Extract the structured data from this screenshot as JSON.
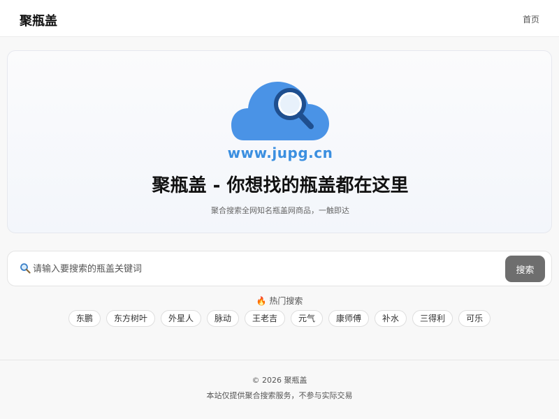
{
  "header": {
    "brand": "聚瓶盖",
    "nav_home": "首页"
  },
  "hero": {
    "logo_icon": "cloud-search-icon",
    "logo_text": "www.jupg.cn",
    "title": "聚瓶盖 - 你想找的瓶盖都在这里",
    "subtitle": "聚合搜索全网知名瓶盖网商品，一触即达"
  },
  "search": {
    "placeholder": "请输入要搜索的瓶盖关键词",
    "value": "",
    "button_label": "搜索"
  },
  "hot": {
    "title": "🔥 热门搜索",
    "tags": [
      "东鹏",
      "东方树叶",
      "外星人",
      "脉动",
      "王老吉",
      "元气",
      "康师傅",
      "补水",
      "三得利",
      "可乐"
    ]
  },
  "footer": {
    "copyright": "© 2026 聚瓶盖",
    "note": "本站仅提供聚合搜索服务，不参与实际交易"
  },
  "colors": {
    "accent": "#3b8fe0",
    "cloud": "#4a93e6",
    "button": "#6e6e6e"
  }
}
